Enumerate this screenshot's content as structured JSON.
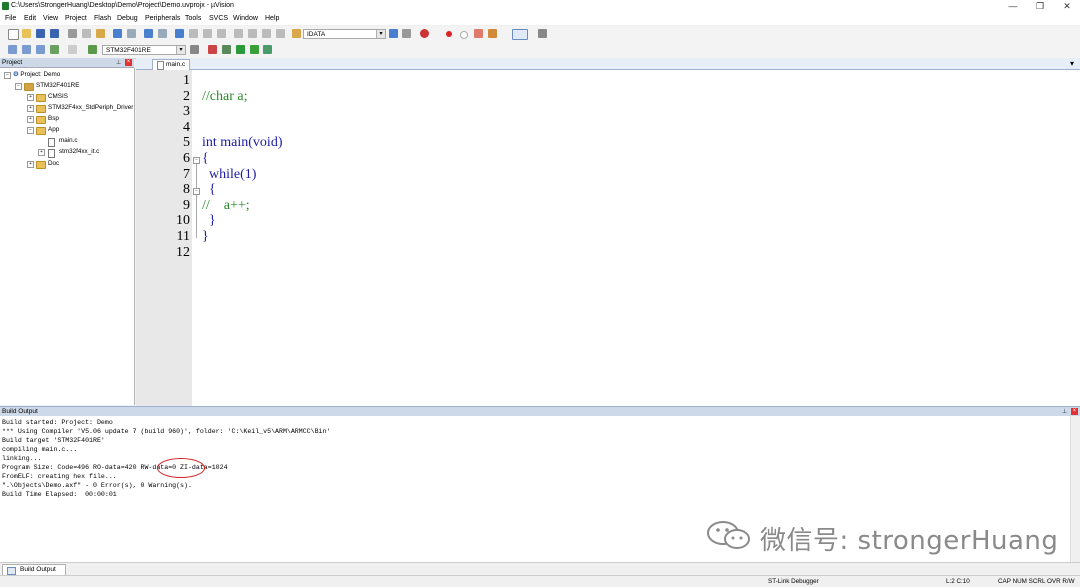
{
  "window": {
    "title": "C:\\Users\\StrongerHuang\\Desktop\\Demo\\Project\\Demo.uvprojx - µVision",
    "minimize": "—",
    "maximize": "❐",
    "close": "✕"
  },
  "menu": [
    "File",
    "Edit",
    "View",
    "Project",
    "Flash",
    "Debug",
    "Peripherals",
    "Tools",
    "SVCS",
    "Window",
    "Help"
  ],
  "toolbar": {
    "find_value": "IDATA",
    "target_value": "STM32F401RE"
  },
  "project_panel": {
    "header": "Project",
    "root": "Project: Demo",
    "target": "STM32F401RE",
    "groups": [
      "CMSIS",
      "STM32F4xx_StdPeriph_Driver",
      "Bsp",
      "App",
      "Doc"
    ],
    "app_files": [
      "main.c",
      "stm32f4xx_it.c"
    ]
  },
  "editor": {
    "tab_label": "main.c",
    "tab_menu": "▾",
    "line_numbers": [
      "1",
      "2",
      "3",
      "4",
      "5",
      "6",
      "7",
      "8",
      "9",
      "10",
      "11",
      "12"
    ],
    "lines": [
      "",
      "//char a;",
      "",
      "",
      "int main(void)",
      "{",
      "  while(1)",
      "  {",
      "//    a++;",
      "  }",
      "}",
      ""
    ]
  },
  "build_output": {
    "header": "Build Output",
    "lines": [
      "Build started: Project: Demo",
      "*** Using Compiler 'V5.06 update 7 (build 960)', folder: 'C:\\Keil_v5\\ARM\\ARMCC\\Bin'",
      "Build target 'STM32F401RE'",
      "compiling main.c...",
      "linking...",
      "Program Size: Code=496 RO-data=420 RW-data=0 ZI-data=1024",
      "FromELF: creating hex file...",
      "\".\\Objects\\Demo.axf\" - 0 Error(s), 0 Warning(s).",
      "Build Time Elapsed:  00:00:01"
    ],
    "highlight_color": "#d21f1f"
  },
  "bottom_tab": "Build Output",
  "status": {
    "debugger": "ST-Link Debugger",
    "position": "L:2 C:10",
    "flags": "CAP  NUM  SCRL  OVR  R/W"
  },
  "watermark": "微信号: strongerHuang",
  "colors": {
    "keyword": "#1a1aa6",
    "comment": "#2a8a2a",
    "panel_header": "#cdd8e8"
  }
}
